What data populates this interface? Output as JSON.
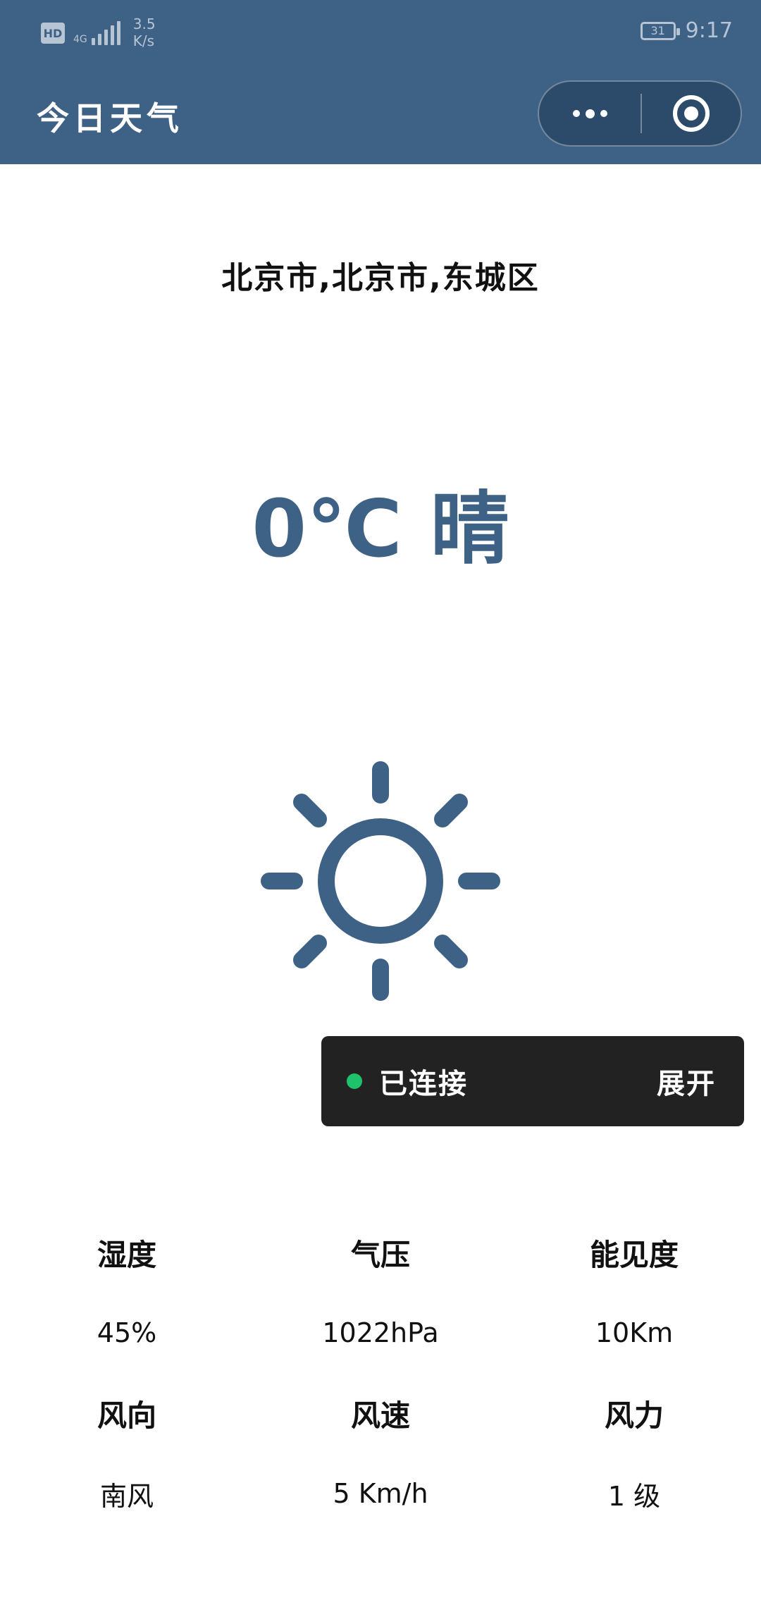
{
  "status_bar": {
    "hd": "HD",
    "network": "4G",
    "speed_value": "3.5",
    "speed_unit": "K/s",
    "battery": "31",
    "time": "9:17"
  },
  "header": {
    "title": "今日天气"
  },
  "weather": {
    "location": "北京市,北京市,东城区",
    "temperature": "0℃",
    "condition": "晴",
    "icon": "sun-icon"
  },
  "toast": {
    "status": "已连接",
    "action": "展开",
    "dot_color": "#1ec26a"
  },
  "details": {
    "row1_labels": [
      "湿度",
      "气压",
      "能见度"
    ],
    "row1_values": [
      "45%",
      "1022hPa",
      "10Km"
    ],
    "row2_labels": [
      "风向",
      "风速",
      "风力"
    ],
    "row2_values": [
      "南风",
      "5 Km/h",
      "1 级"
    ]
  },
  "colors": {
    "accent": "#3e6186"
  }
}
